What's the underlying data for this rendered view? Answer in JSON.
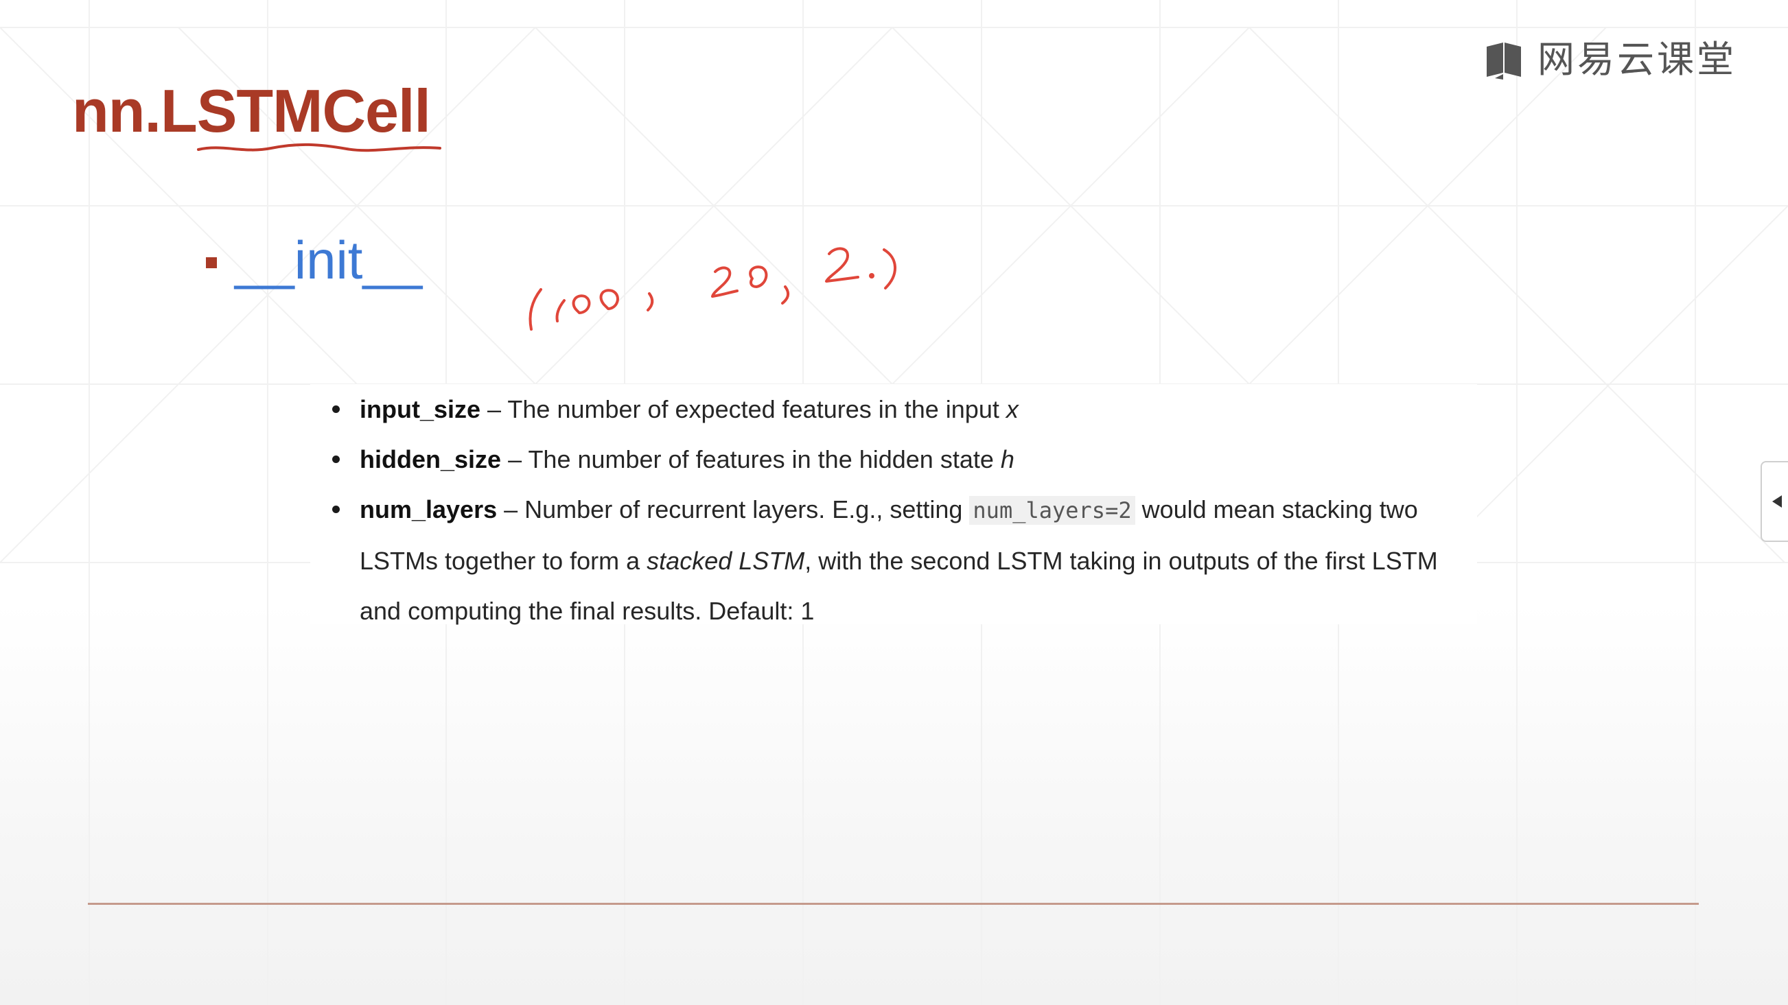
{
  "brand": {
    "logo_text": "网易云课堂",
    "icon": "book-icon"
  },
  "slide": {
    "title": "nn.LSTMCell",
    "subheading": "__init__",
    "handwritten_note": "((100, 20, 2)"
  },
  "doc": {
    "items": [
      {
        "param": "input_size",
        "sep": " – ",
        "text": "The number of expected features in the input ",
        "symbol": "x"
      },
      {
        "param": "hidden_size",
        "sep": " – ",
        "text": "The number of features in the hidden state ",
        "symbol": "h"
      },
      {
        "param": "num_layers",
        "sep": " – ",
        "text_a": "Number of recurrent layers. E.g., setting ",
        "code": "num_layers=2",
        "text_b": " would mean stacking two LSTMs together to form a ",
        "emph": "stacked LSTM",
        "text_c": ", with the second LSTM taking in outputs of the first LSTM and computing the final results. Default: 1"
      }
    ]
  },
  "side_tab": {
    "icon": "collapse-arrow-icon"
  },
  "colors": {
    "title": "#a93a26",
    "subheading": "#3d79d4",
    "annotation_ink": "#e0463a",
    "rule": "#c59a8c"
  }
}
